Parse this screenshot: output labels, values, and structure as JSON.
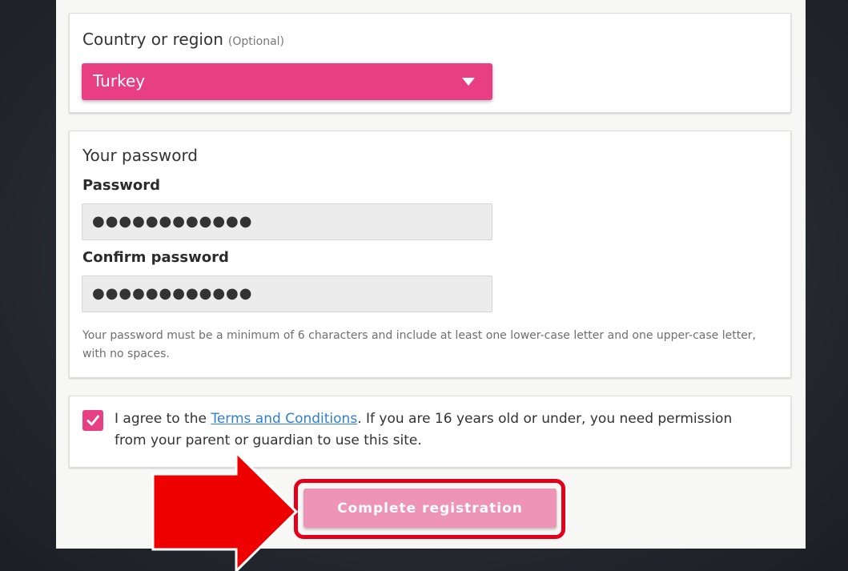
{
  "country": {
    "label": "Country or region",
    "optional": "(Optional)",
    "selected": "Turkey"
  },
  "password_section": {
    "title": "Your password",
    "password_label": "Password",
    "password_value": "●●●●●●●●●●●●",
    "confirm_label": "Confirm password",
    "confirm_value": "●●●●●●●●●●●●",
    "hint": "Your password must be a minimum of 6 characters and include at least one lower-case letter and one upper-case letter, with no spaces."
  },
  "terms": {
    "checked": true,
    "prefix": "I agree to the ",
    "link_text": "Terms and Conditions",
    "suffix": ". If you are 16 years old or under, you need permission from your parent or guardian to use this site."
  },
  "submit": {
    "label": "Complete registration"
  },
  "colors": {
    "accent": "#e83e84",
    "button_disabled": "#ee95b7",
    "link": "#2f7fd6",
    "callout": "#e3001b"
  },
  "icons": {
    "dropdown": "chevron-down-icon",
    "checkbox": "checkmark-icon",
    "callout": "arrow-right-icon"
  }
}
